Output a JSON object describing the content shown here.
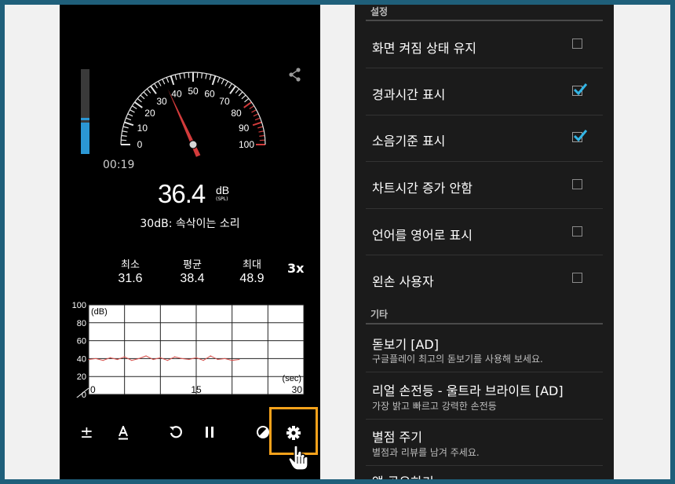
{
  "meter": {
    "timer": "00:19",
    "level_fraction": 0.37,
    "gauge": {
      "ticks": [
        "0",
        "10",
        "20",
        "30",
        "40",
        "50",
        "60",
        "70",
        "80",
        "90",
        "100"
      ],
      "needle_value": 36.4
    },
    "reading": {
      "value": "36.4",
      "unit": "dB",
      "unit_sub": "(SPL)"
    },
    "description": "30dB: 속삭이는 소리",
    "stats": [
      {
        "label": "최소",
        "value": "31.6"
      },
      {
        "label": "평균",
        "value": "38.4"
      },
      {
        "label": "최대",
        "value": "48.9"
      }
    ],
    "multiplier": "3x",
    "chart": {
      "y_ticks": [
        "100",
        "80",
        "60",
        "40",
        "20",
        "0"
      ],
      "x_ticks": [
        "0",
        "15",
        "30"
      ],
      "ylabel": "(dB)",
      "xlabel": "(sec)"
    },
    "toolbar": [
      "plus-minus-icon",
      "text-a-icon",
      "reset-icon",
      "pause-icon",
      "contrast-icon",
      "settings-icon"
    ]
  },
  "settings": {
    "section_settings": "설정",
    "items": [
      {
        "label": "화면 켜짐 상태 유지",
        "checked": false
      },
      {
        "label": "경과시간 표시",
        "checked": true
      },
      {
        "label": "소음기준 표시",
        "checked": true
      },
      {
        "label": "차트시간 증가 안함",
        "checked": false
      },
      {
        "label": "언어를 영어로 표시",
        "checked": false
      },
      {
        "label": "왼손 사용자",
        "checked": false
      }
    ],
    "section_other": "기타",
    "other_items": [
      {
        "title": "돋보기 [AD]",
        "subtitle": "구글플레이 최고의 돋보기를 사용해 보세요."
      },
      {
        "title": "리얼 손전등 - 울트라 브라이트 [AD]",
        "subtitle": "가장 밝고 빠르고 강력한 손전등"
      },
      {
        "title": "별점 주기",
        "subtitle": "별점과 리뷰를 남겨 주세요."
      },
      {
        "title": "앱 공유하기",
        "subtitle": ""
      }
    ]
  },
  "colors": {
    "accent_highlight": "#f7a21b",
    "level_blue": "#2b97d4",
    "needle_red": "#d23b3b",
    "chart_line": "#d9534f",
    "check_blue": "#33b5e5"
  },
  "chart_data": {
    "type": "line",
    "xlabel": "(sec)",
    "ylabel": "(dB)",
    "xlim": [
      0,
      30
    ],
    "ylim": [
      0,
      100
    ],
    "x": [
      0,
      1,
      2,
      3,
      4,
      5,
      6,
      7,
      8,
      9,
      10,
      11,
      12,
      13,
      14,
      15,
      16,
      17,
      18,
      19,
      20,
      21
    ],
    "values": [
      39,
      40,
      38,
      41,
      39,
      42,
      38,
      40,
      43,
      39,
      41,
      38,
      42,
      40,
      39,
      41,
      38,
      43,
      39,
      40,
      38,
      39
    ]
  }
}
